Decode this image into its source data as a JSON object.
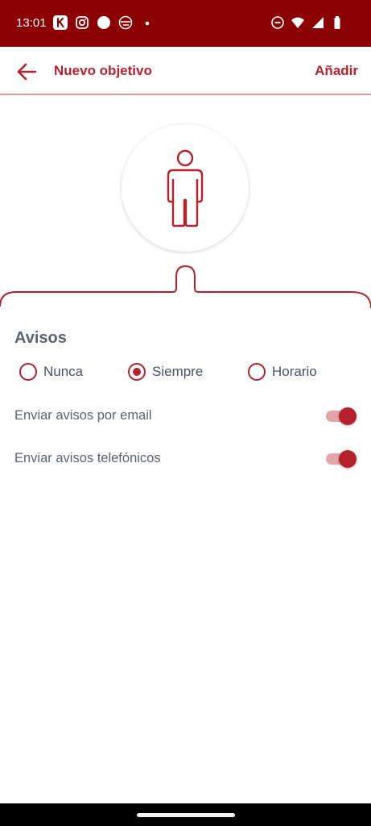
{
  "status_bar": {
    "time": "13:01",
    "left_icons": [
      "k-app-icon",
      "instagram-icon",
      "dot-circle-icon",
      "globe-icon",
      "small-dot-icon"
    ],
    "right_icons": [
      "do-not-disturb-icon",
      "wifi-icon",
      "signal-icon",
      "battery-icon"
    ],
    "background": "#8b0000"
  },
  "appbar": {
    "title": "Nuevo objetivo",
    "action_label": "Añadir",
    "accent": "#b5222d"
  },
  "section": {
    "title": "Avisos",
    "radios": [
      {
        "label": "Nunca",
        "checked": false
      },
      {
        "label": "Siempre",
        "checked": true
      },
      {
        "label": "Horario",
        "checked": false
      }
    ],
    "settings": [
      {
        "label": "Enviar avisos por email",
        "enabled": true
      },
      {
        "label": "Enviar avisos telefónicos",
        "enabled": true
      }
    ]
  }
}
